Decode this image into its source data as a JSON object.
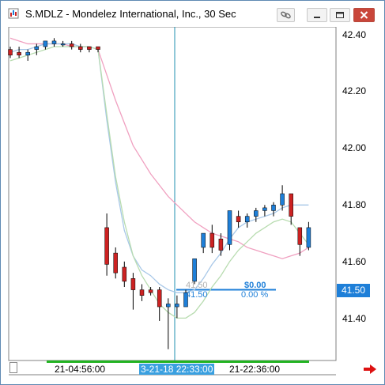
{
  "window": {
    "title": "S.MDLZ - Mondelez International, Inc., 30 Sec",
    "icons": [
      "app-icon",
      "link-icon",
      "minimize-icon",
      "restore-icon",
      "close-icon"
    ]
  },
  "price_axis": {
    "ticks": [
      "42.40",
      "42.20",
      "42.00",
      "41.80",
      "41.60",
      "41.40"
    ],
    "current_price": "41.50"
  },
  "time_axis": {
    "labels": [
      "21-04:56:00",
      "3-21-18 22:33:00",
      "21-22:36:00"
    ]
  },
  "crosshair": {
    "price_left": "41.50",
    "price_right": "41.50",
    "change_value": "$0.00",
    "change_percent": "0.00 %"
  },
  "colors": {
    "up_candle": "#1e7fd8",
    "down_candle": "#cc2222",
    "ma_pink": "#f0a0c0",
    "ma_blue": "#a8c8e8",
    "ma_green": "#b8dcb0",
    "crosshair": "#2090b0",
    "accent": "#1e7fd8",
    "arrow": "#dd1111"
  },
  "chart_data": {
    "type": "candlestick",
    "price_range": [
      41.25,
      42.43
    ],
    "candles": [
      {
        "o": 42.35,
        "h": 42.36,
        "l": 42.32,
        "c": 42.33
      },
      {
        "o": 42.34,
        "h": 42.36,
        "l": 42.32,
        "c": 42.33
      },
      {
        "o": 42.33,
        "h": 42.35,
        "l": 42.31,
        "c": 42.34
      },
      {
        "o": 42.35,
        "h": 42.37,
        "l": 42.33,
        "c": 42.36
      },
      {
        "o": 42.36,
        "h": 42.38,
        "l": 42.35,
        "c": 42.38
      },
      {
        "o": 42.37,
        "h": 42.39,
        "l": 42.36,
        "c": 42.38
      },
      {
        "o": 42.37,
        "h": 42.38,
        "l": 42.36,
        "c": 42.37
      },
      {
        "o": 42.37,
        "h": 42.38,
        "l": 42.35,
        "c": 42.36
      },
      {
        "o": 42.36,
        "h": 42.37,
        "l": 42.34,
        "c": 42.35
      },
      {
        "o": 42.36,
        "h": 42.36,
        "l": 42.34,
        "c": 42.35
      },
      {
        "o": 42.36,
        "h": 42.36,
        "l": 42.34,
        "c": 42.35
      },
      {
        "o": 41.72,
        "h": 41.77,
        "l": 41.55,
        "c": 41.59
      },
      {
        "o": 41.63,
        "h": 41.65,
        "l": 41.54,
        "c": 41.56
      },
      {
        "o": 41.58,
        "h": 41.6,
        "l": 41.51,
        "c": 41.53
      },
      {
        "o": 41.54,
        "h": 41.56,
        "l": 41.43,
        "c": 41.5
      },
      {
        "o": 41.5,
        "h": 41.52,
        "l": 41.46,
        "c": 41.48
      },
      {
        "o": 41.5,
        "h": 41.51,
        "l": 41.48,
        "c": 41.49
      },
      {
        "o": 41.5,
        "h": 41.51,
        "l": 41.39,
        "c": 41.44
      },
      {
        "o": 41.44,
        "h": 41.47,
        "l": 41.29,
        "c": 41.45
      },
      {
        "o": 41.44,
        "h": 41.48,
        "l": 41.4,
        "c": 41.45
      },
      {
        "o": 41.44,
        "h": 41.5,
        "l": 41.44,
        "c": 41.49
      },
      {
        "o": 41.53,
        "h": 41.61,
        "l": 41.52,
        "c": 41.61
      },
      {
        "o": 41.65,
        "h": 41.7,
        "l": 41.63,
        "c": 41.7
      },
      {
        "o": 41.7,
        "h": 41.73,
        "l": 41.63,
        "c": 41.65
      },
      {
        "o": 41.68,
        "h": 41.7,
        "l": 41.62,
        "c": 41.64
      },
      {
        "o": 41.66,
        "h": 41.78,
        "l": 41.64,
        "c": 41.78
      },
      {
        "o": 41.76,
        "h": 41.78,
        "l": 41.72,
        "c": 41.74
      },
      {
        "o": 41.74,
        "h": 41.77,
        "l": 41.72,
        "c": 41.76
      },
      {
        "o": 41.76,
        "h": 41.79,
        "l": 41.74,
        "c": 41.78
      },
      {
        "o": 41.78,
        "h": 41.8,
        "l": 41.76,
        "c": 41.79
      },
      {
        "o": 41.78,
        "h": 41.81,
        "l": 41.76,
        "c": 41.8
      },
      {
        "o": 41.8,
        "h": 41.87,
        "l": 41.78,
        "c": 41.84
      },
      {
        "o": 41.84,
        "h": 41.84,
        "l": 41.73,
        "c": 41.76
      },
      {
        "o": 41.72,
        "h": 41.72,
        "l": 41.62,
        "c": 41.66
      },
      {
        "o": 41.65,
        "h": 41.74,
        "l": 41.64,
        "c": 41.72
      }
    ],
    "ma_pink": [
      42.39,
      42.38,
      42.37,
      42.37,
      42.37,
      42.37,
      42.37,
      42.36,
      42.36,
      42.36,
      42.35,
      42.26,
      42.17,
      42.09,
      42.01,
      41.96,
      41.91,
      41.87,
      41.83,
      41.8,
      41.77,
      41.74,
      41.72,
      41.7,
      41.69,
      41.68,
      41.67,
      41.65,
      41.64,
      41.63,
      41.62,
      41.61,
      41.62,
      41.63,
      41.65
    ],
    "ma_blue": [
      42.34,
      42.35,
      42.35,
      42.36,
      42.37,
      42.37,
      42.37,
      42.37,
      42.36,
      42.36,
      42.35,
      42.1,
      41.88,
      41.71,
      41.62,
      41.57,
      41.55,
      41.52,
      41.5,
      41.49,
      41.49,
      41.5,
      41.54,
      41.59,
      41.63,
      41.68,
      41.72,
      41.74,
      41.75,
      41.76,
      41.77,
      41.79,
      41.8,
      41.8,
      41.8
    ],
    "ma_green": [
      42.31,
      42.32,
      42.33,
      42.34,
      42.35,
      42.36,
      42.36,
      42.36,
      42.36,
      42.36,
      42.35,
      42.12,
      41.9,
      41.74,
      41.62,
      41.55,
      41.5,
      41.45,
      41.42,
      41.4,
      41.4,
      41.42,
      41.46,
      41.51,
      41.55,
      41.6,
      41.64,
      41.67,
      41.7,
      41.72,
      41.74,
      41.75,
      41.74,
      41.7,
      41.66
    ]
  }
}
